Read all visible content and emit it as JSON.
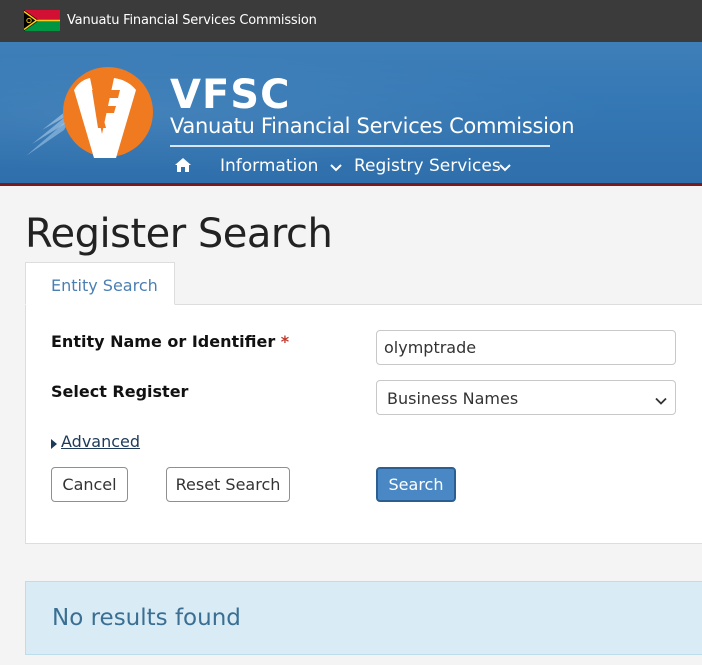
{
  "topbar": {
    "title": "Vanuatu Financial Services Commission"
  },
  "header": {
    "brand_abbrev": "VFSC",
    "brand_full": "Vanuatu Financial Services Commission",
    "nav": {
      "information": "Information",
      "registry_services": "Registry Services"
    }
  },
  "page": {
    "title": "Register Search"
  },
  "tabs": {
    "entity_search": "Entity Search"
  },
  "form": {
    "entity_label": "Entity Name or Identifier",
    "required_mark": "*",
    "entity_value": "olymptrade",
    "register_label": "Select Register",
    "register_value": "Business Names",
    "advanced_label": "Advanced",
    "cancel_label": "Cancel",
    "reset_label": "Reset Search",
    "search_label": "Search"
  },
  "alert": {
    "message": "No results found"
  },
  "colors": {
    "topbar": "#3b3b3b",
    "header": "#3478b5",
    "header_border": "#7a1a1a",
    "logo_orange": "#f07a1f",
    "primary_button": "#4a88c5",
    "alert_bg": "#d9ecf5",
    "alert_text": "#3a6f93"
  },
  "icons": {
    "home": "home-icon",
    "chevron": "chevron-down-icon",
    "caret": "caret-right-icon"
  }
}
